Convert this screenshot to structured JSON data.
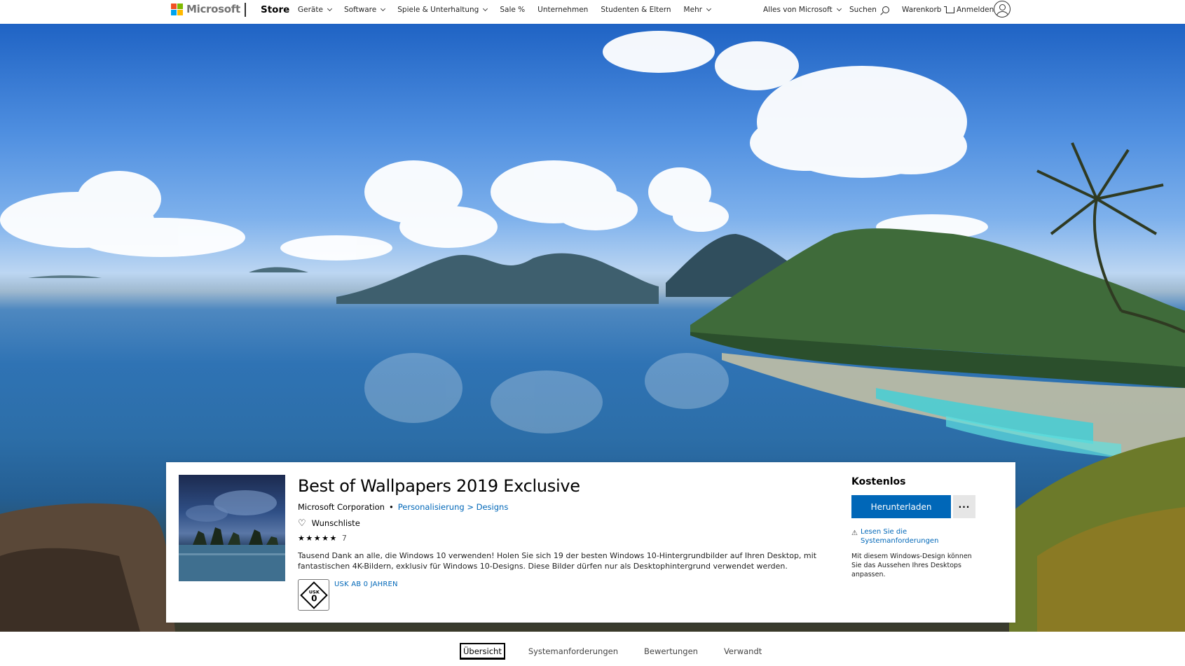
{
  "header": {
    "brand": "Microsoft",
    "store": "Store",
    "nav": [
      {
        "label": "Geräte",
        "has_dropdown": true
      },
      {
        "label": "Software",
        "has_dropdown": true
      },
      {
        "label": "Spiele & Unterhaltung",
        "has_dropdown": true
      },
      {
        "label": "Sale %",
        "has_dropdown": false
      },
      {
        "label": "Unternehmen",
        "has_dropdown": false
      },
      {
        "label": "Studenten & Eltern",
        "has_dropdown": false
      },
      {
        "label": "Mehr",
        "has_dropdown": true
      }
    ],
    "all_microsoft": "Alles von Microsoft",
    "search": "Suchen",
    "cart": "Warenkorb",
    "signin": "Anmelden"
  },
  "product": {
    "title": "Best of Wallpapers 2019 Exclusive",
    "publisher": "Microsoft Corporation",
    "separator": "•",
    "category": "Personalisierung > Designs",
    "wishlist": "Wunschliste",
    "stars": "★★★★★",
    "rating_count": "7",
    "description": "Tausend Dank an alle, die Windows 10 verwenden! Holen Sie sich 19 der besten Windows 10-Hintergrundbilder auf Ihren Desktop, mit fantastischen 4K-Bildern, exklusiv für Windows 10-Designs. Diese Bilder dürfen nur als Desktophintergrund verwendet werden.",
    "usk_top": "USK",
    "usk_num": "0",
    "usk_label": "USK AB 0 JAHREN",
    "price": "Kostenlos",
    "download": "Herunterladen",
    "more": "···",
    "sysreq_link": "Lesen Sie die Systemanforderungen",
    "theme_note": "Mit diesem Windows-Design können Sie das Aussehen Ihres Desktops anpassen."
  },
  "tabs": [
    "Übersicht",
    "Systemanforderungen",
    "Bewertungen",
    "Verwandt"
  ],
  "colors": {
    "accent": "#0067b8",
    "logo": [
      "#f25022",
      "#7fba00",
      "#00a4ef",
      "#ffb900"
    ]
  }
}
